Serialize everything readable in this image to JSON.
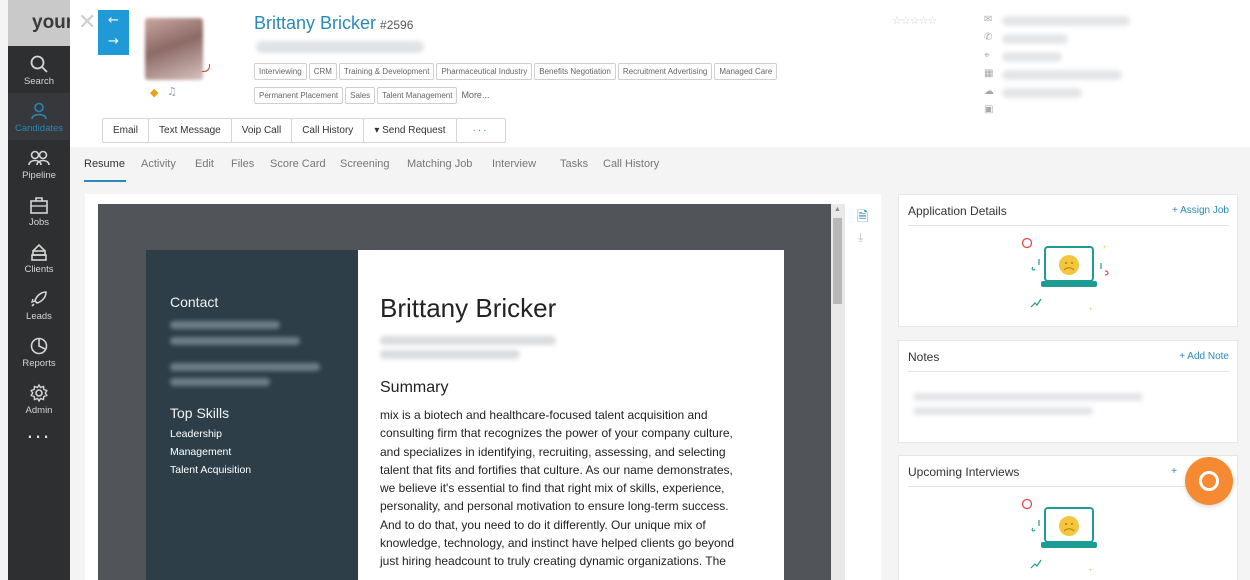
{
  "nav": {
    "logo": "your",
    "items": [
      {
        "label": "Search",
        "icon": "search-icon"
      },
      {
        "label": "Candidates",
        "icon": "person-icon"
      },
      {
        "label": "Pipeline",
        "icon": "people-icon"
      },
      {
        "label": "Jobs",
        "icon": "briefcase-icon"
      },
      {
        "label": "Clients",
        "icon": "building-icon"
      },
      {
        "label": "Leads",
        "icon": "rocket-icon"
      },
      {
        "label": "Reports",
        "icon": "pie-icon"
      },
      {
        "label": "Admin",
        "icon": "gear-icon"
      }
    ],
    "more": "..."
  },
  "header": {
    "name": "Brittany Bricker",
    "id": "#2596",
    "tags": [
      "Interviewing",
      "CRM",
      "Training & Development",
      "Pharmaceutical Industry",
      "Benefits Negotiation",
      "Recruitment Advertising",
      "Managed Care",
      "Permanent Placement",
      "Sales",
      "Talent Management"
    ],
    "tags_more": "More..."
  },
  "actions": {
    "email": "Email",
    "text": "Text Message",
    "voip": "Voip Call",
    "history": "Call History",
    "send_request": "Send Request",
    "more": "···"
  },
  "tabs": [
    "Resume",
    "Activity",
    "Edit",
    "Files",
    "Score Card",
    "Screening",
    "Matching Job",
    "Interview",
    "Tasks",
    "Call History"
  ],
  "resume": {
    "contact_heading": "Contact",
    "top_skills_heading": "Top Skills",
    "skills": [
      "Leadership",
      "Management",
      "Talent Acquisition"
    ],
    "name": "Brittany Bricker",
    "summary_heading": "Summary",
    "summary_lines": [
      "mix is a biotech and healthcare-focused talent acquisition and",
      "consulting firm that recognizes the power of your company culture,",
      "and specializes in identifying, recruiting, assessing, and selecting",
      "talent that fits and fortifies that culture. As our name demonstrates,",
      "we believe it's essential to find that right mix of skills, experience,",
      "personality, and personal motivation to ensure long-term success.",
      "And to do that, you need to do it differently. Our unique mix of",
      "knowledge, technology, and instinct have helped clients go beyond",
      "just hiring headcount to truly creating dynamic organizations. The"
    ]
  },
  "cards": {
    "application": {
      "title": "Application Details",
      "link": "+ Assign Job"
    },
    "notes": {
      "title": "Notes",
      "link": "+ Add Note"
    },
    "interviews": {
      "title": "Upcoming Interviews",
      "link": "+"
    }
  },
  "colors": {
    "accent": "#2a8ab9",
    "nav_bg": "#2e2f31",
    "chat": "#f58a33",
    "illustration": "#1d9c95"
  }
}
